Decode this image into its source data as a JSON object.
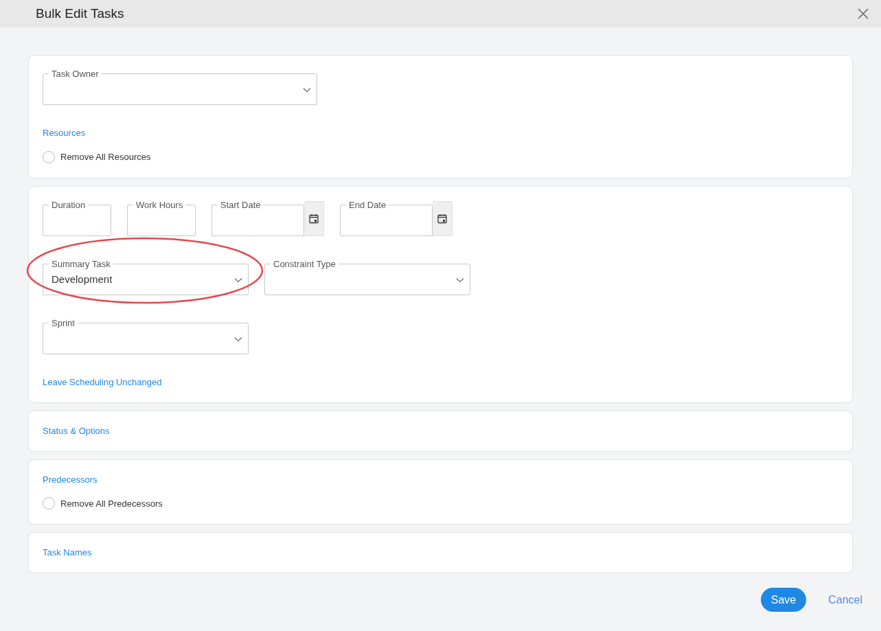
{
  "window": {
    "title": "Bulk Edit Tasks"
  },
  "sections": [
    {
      "rows": [
        [
          {
            "kind": "select",
            "label": "Task Owner"
          }
        ]
      ],
      "link": "Resources",
      "radio": {
        "label": "Remove All Resources",
        "selected": false
      }
    },
    {
      "rows": [
        [
          {
            "kind": "text",
            "label": "Duration"
          },
          {
            "kind": "text",
            "label": "Work Hours"
          },
          {
            "kind": "date",
            "label": "Start Date"
          },
          {
            "kind": "date",
            "label": "End Date"
          }
        ],
        [
          {
            "kind": "select",
            "label": "Summary Task",
            "value": "Development"
          },
          {
            "kind": "select",
            "label": "Constraint Type"
          }
        ],
        [
          {
            "kind": "select",
            "label": "Sprint"
          }
        ]
      ],
      "link": "Leave Scheduling Unchanged",
      "annotation": {
        "kind": "ellipse"
      }
    },
    {
      "link": "Status & Options"
    },
    {
      "link": "Predecessors",
      "radio": {
        "label": "Remove All Predecessors",
        "selected": false
      }
    },
    {
      "link": "Task Names"
    }
  ],
  "buttons": {
    "save": "Save",
    "cancel": "Cancel"
  }
}
